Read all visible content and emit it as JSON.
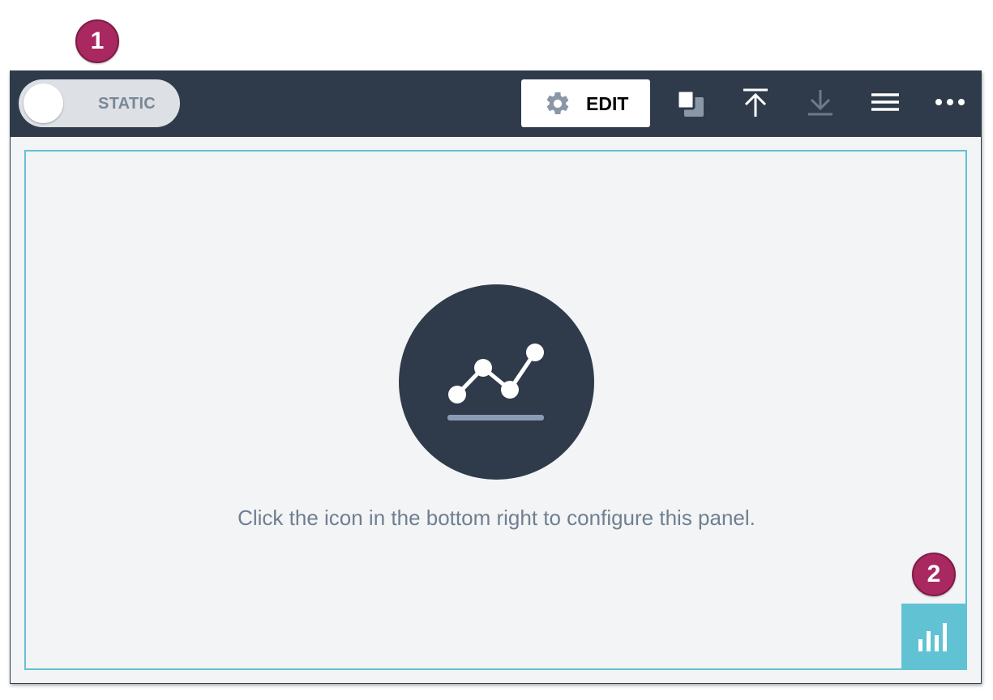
{
  "annotations": {
    "badge_1": "1",
    "badge_2": "2"
  },
  "toolbar": {
    "toggle_label": "STATIC",
    "edit_label": "EDIT",
    "icons": [
      "gear-icon",
      "duplicate-icon",
      "upload-icon",
      "download-icon",
      "menu-icon",
      "more-icon"
    ]
  },
  "panel": {
    "message": "Click the icon in the bottom right to configure this panel.",
    "placeholder_icon": "line-chart-icon",
    "config_icon": "bar-chart-icon"
  },
  "colors": {
    "toolbar_bg": "#2f3b4b",
    "accent": "#61c2d3",
    "badge": "#a8285f",
    "panel_bg": "#f3f4f6"
  }
}
